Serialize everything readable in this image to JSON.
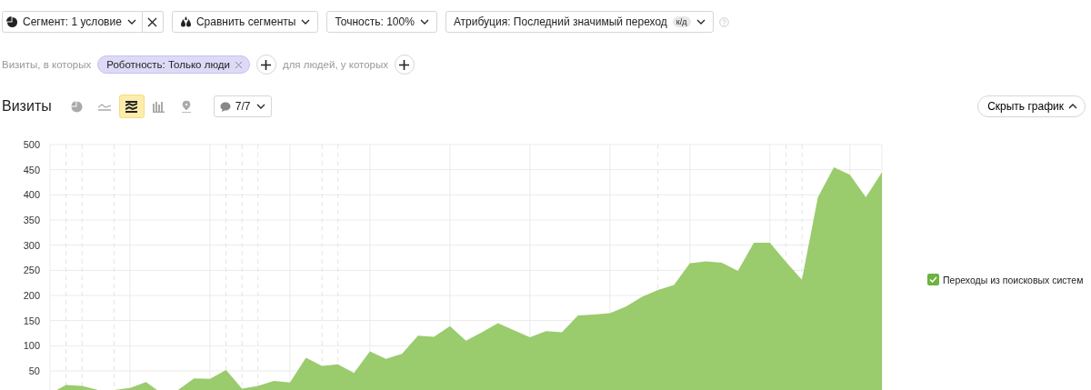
{
  "toolbar": {
    "segment": {
      "label": "Сегмент: 1 условие"
    },
    "compare": {
      "label": "Сравнить сегменты"
    },
    "accuracy": {
      "label": "Точность: 100%"
    },
    "attribution": {
      "label": "Атрибуция: Последний значимый переход",
      "badge": "к/д"
    }
  },
  "filters": {
    "prefix": "Визиты, в которых",
    "chip": "Роботность: Только люди",
    "joiner": "для людей, у которых"
  },
  "chart_header": {
    "title": "Визиты",
    "chart_types": [
      {
        "kind": "pie",
        "selected": false
      },
      {
        "kind": "line",
        "selected": false
      },
      {
        "kind": "area",
        "selected": true
      },
      {
        "kind": "bar",
        "selected": false
      },
      {
        "kind": "map",
        "selected": false
      }
    ],
    "annotations": "7/7",
    "hide_button": "Скрыть график"
  },
  "chart": {
    "chart_data": {
      "type": "area",
      "grid": true,
      "ylim": [
        0,
        500
      ],
      "yticks": [
        50,
        100,
        150,
        200,
        250,
        300,
        350,
        400,
        450,
        500
      ],
      "series": [
        {
          "name": "Переходы из поисковых систем",
          "color": "#95c865",
          "values": [
            5,
            22,
            20,
            12,
            12,
            16,
            28,
            5,
            12,
            35,
            34,
            52,
            15,
            20,
            30,
            27,
            76,
            60,
            63,
            46,
            89,
            74,
            84,
            120,
            118,
            139,
            110,
            127,
            145,
            131,
            117,
            129,
            127,
            160,
            162,
            165,
            178,
            197,
            211,
            221,
            264,
            268,
            265,
            249,
            305,
            305,
            267,
            231,
            395,
            455,
            440,
            395,
            445
          ]
        }
      ]
    }
  },
  "legend": [
    {
      "checked": true,
      "color": "#6cb33f"
    }
  ]
}
